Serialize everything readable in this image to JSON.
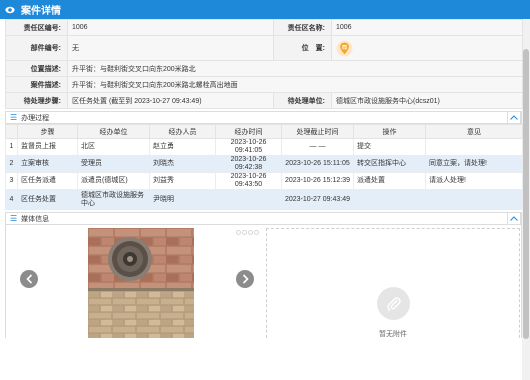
{
  "window": {
    "title": "案件详情"
  },
  "info": {
    "rows": [
      {
        "l1": "责任区编号:",
        "v1": "1006",
        "l2": "责任区名称:",
        "v2": "1006"
      },
      {
        "l1": "部件编号:",
        "v1": "无",
        "l2": "位　置:"
      }
    ],
    "location_desc_label": "位置描述:",
    "location_desc": "升平街：与鞋利街交叉口向东200米路北",
    "case_desc_label": "案件描述:",
    "case_desc": "升平街：与鞋利街交叉口向东200米路北螺栓高出地面",
    "pending_step_label": "待处理步骤:",
    "pending_step": "区任务处置 (截至到 2023-10-27 09:43:49)",
    "pending_unit_label": "待处理单位:",
    "pending_unit": "德城区市政设施服务中心(dcsz01)"
  },
  "process": {
    "title": "办理过程",
    "headers": [
      "",
      "步骤",
      "经办单位",
      "经办人员",
      "经办时间",
      "处理截止时间",
      "操作",
      "意见"
    ],
    "rows": [
      {
        "no": "1",
        "step": "监督员上报",
        "unit": "北区",
        "person": "赵立勇",
        "time": "2023-10-26 09:41:05",
        "deadline": "— —",
        "op": "提交",
        "opinion": ""
      },
      {
        "no": "2",
        "step": "立案审核",
        "unit": "受理员",
        "person": "刘晓杰",
        "time": "2023-10-26 09:42:38",
        "deadline": "2023-10-26 15:11:05",
        "op": "转交区指挥中心",
        "opinion": "同意立案，请处理!"
      },
      {
        "no": "3",
        "step": "区任务派遣",
        "unit": "派遣员(德城区)",
        "person": "刘益秀",
        "time": "2023-10-26 09:43:50",
        "deadline": "2023-10-26 15:12:39",
        "op": "派遣处置",
        "opinion": "请派人处理!"
      },
      {
        "no": "4",
        "step": "区任务处置",
        "unit": "德城区市政设施服务中心",
        "person": "尹晓明",
        "time": "",
        "deadline": "2023-10-27 09:43:49",
        "op": "",
        "opinion": ""
      }
    ]
  },
  "media": {
    "title": "媒体信息",
    "upload_label": "暂无附件"
  },
  "colors": {
    "title_bar": "#1e88d9",
    "accent": "#1e88d9",
    "row_alt": "#e4eef8",
    "label_bg": "#f3f3f3",
    "location_icon": "#f5a623"
  },
  "icons": [
    "eye-icon",
    "location-pin-icon",
    "menu-icon",
    "chevron-up-icon",
    "chevron-left-icon",
    "chevron-right-icon",
    "paperclip-icon"
  ]
}
